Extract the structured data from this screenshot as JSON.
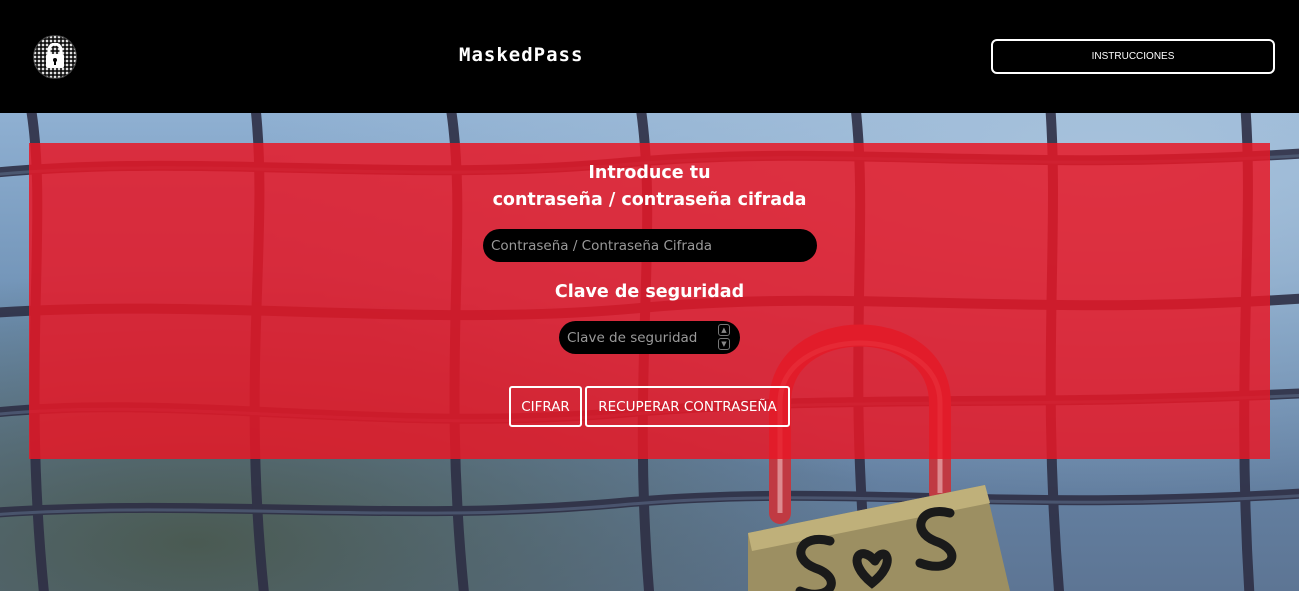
{
  "header": {
    "logo_icon": "lock-icon",
    "brand": "MaskedPass",
    "instructions_label": "INSTRUCCIONES"
  },
  "form": {
    "title_line1": "Introduce tu",
    "title_line2": "contraseña / contraseña cifrada",
    "password_placeholder": "Contraseña / Contraseña Cifrada",
    "password_value": "",
    "key_title": "Clave de seguridad",
    "key_placeholder": "Clave de seguridad",
    "key_value": "",
    "cifrar_label": "CIFRAR",
    "recuperar_label": "RECUPERAR CONTRASEÑA"
  },
  "colors": {
    "header_bg": "#000000",
    "panel_bg": "#e81826",
    "button_border": "#ffffff",
    "input_bg": "#000000"
  }
}
